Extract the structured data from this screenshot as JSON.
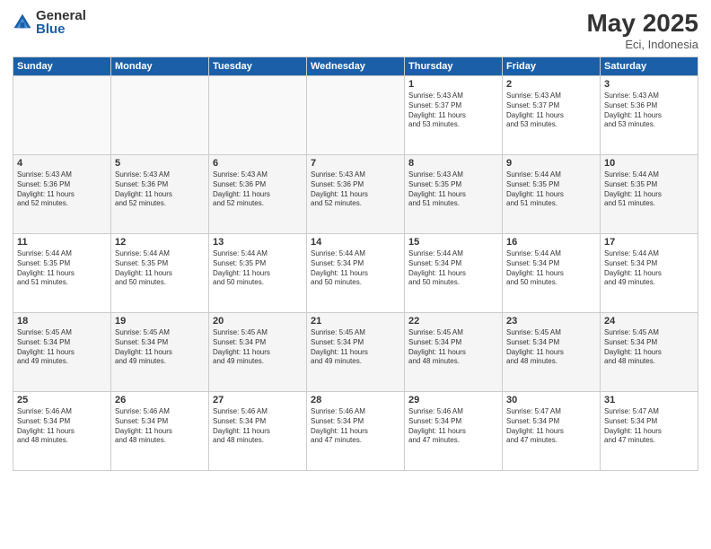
{
  "header": {
    "logo_general": "General",
    "logo_blue": "Blue",
    "month_year": "May 2025",
    "location": "Eci, Indonesia"
  },
  "days_of_week": [
    "Sunday",
    "Monday",
    "Tuesday",
    "Wednesday",
    "Thursday",
    "Friday",
    "Saturday"
  ],
  "weeks": [
    [
      {
        "day": "",
        "lines": []
      },
      {
        "day": "",
        "lines": []
      },
      {
        "day": "",
        "lines": []
      },
      {
        "day": "",
        "lines": []
      },
      {
        "day": "1",
        "lines": [
          "Sunrise: 5:43 AM",
          "Sunset: 5:37 PM",
          "Daylight: 11 hours",
          "and 53 minutes."
        ]
      },
      {
        "day": "2",
        "lines": [
          "Sunrise: 5:43 AM",
          "Sunset: 5:37 PM",
          "Daylight: 11 hours",
          "and 53 minutes."
        ]
      },
      {
        "day": "3",
        "lines": [
          "Sunrise: 5:43 AM",
          "Sunset: 5:36 PM",
          "Daylight: 11 hours",
          "and 53 minutes."
        ]
      }
    ],
    [
      {
        "day": "4",
        "lines": [
          "Sunrise: 5:43 AM",
          "Sunset: 5:36 PM",
          "Daylight: 11 hours",
          "and 52 minutes."
        ]
      },
      {
        "day": "5",
        "lines": [
          "Sunrise: 5:43 AM",
          "Sunset: 5:36 PM",
          "Daylight: 11 hours",
          "and 52 minutes."
        ]
      },
      {
        "day": "6",
        "lines": [
          "Sunrise: 5:43 AM",
          "Sunset: 5:36 PM",
          "Daylight: 11 hours",
          "and 52 minutes."
        ]
      },
      {
        "day": "7",
        "lines": [
          "Sunrise: 5:43 AM",
          "Sunset: 5:36 PM",
          "Daylight: 11 hours",
          "and 52 minutes."
        ]
      },
      {
        "day": "8",
        "lines": [
          "Sunrise: 5:43 AM",
          "Sunset: 5:35 PM",
          "Daylight: 11 hours",
          "and 51 minutes."
        ]
      },
      {
        "day": "9",
        "lines": [
          "Sunrise: 5:44 AM",
          "Sunset: 5:35 PM",
          "Daylight: 11 hours",
          "and 51 minutes."
        ]
      },
      {
        "day": "10",
        "lines": [
          "Sunrise: 5:44 AM",
          "Sunset: 5:35 PM",
          "Daylight: 11 hours",
          "and 51 minutes."
        ]
      }
    ],
    [
      {
        "day": "11",
        "lines": [
          "Sunrise: 5:44 AM",
          "Sunset: 5:35 PM",
          "Daylight: 11 hours",
          "and 51 minutes."
        ]
      },
      {
        "day": "12",
        "lines": [
          "Sunrise: 5:44 AM",
          "Sunset: 5:35 PM",
          "Daylight: 11 hours",
          "and 50 minutes."
        ]
      },
      {
        "day": "13",
        "lines": [
          "Sunrise: 5:44 AM",
          "Sunset: 5:35 PM",
          "Daylight: 11 hours",
          "and 50 minutes."
        ]
      },
      {
        "day": "14",
        "lines": [
          "Sunrise: 5:44 AM",
          "Sunset: 5:34 PM",
          "Daylight: 11 hours",
          "and 50 minutes."
        ]
      },
      {
        "day": "15",
        "lines": [
          "Sunrise: 5:44 AM",
          "Sunset: 5:34 PM",
          "Daylight: 11 hours",
          "and 50 minutes."
        ]
      },
      {
        "day": "16",
        "lines": [
          "Sunrise: 5:44 AM",
          "Sunset: 5:34 PM",
          "Daylight: 11 hours",
          "and 50 minutes."
        ]
      },
      {
        "day": "17",
        "lines": [
          "Sunrise: 5:44 AM",
          "Sunset: 5:34 PM",
          "Daylight: 11 hours",
          "and 49 minutes."
        ]
      }
    ],
    [
      {
        "day": "18",
        "lines": [
          "Sunrise: 5:45 AM",
          "Sunset: 5:34 PM",
          "Daylight: 11 hours",
          "and 49 minutes."
        ]
      },
      {
        "day": "19",
        "lines": [
          "Sunrise: 5:45 AM",
          "Sunset: 5:34 PM",
          "Daylight: 11 hours",
          "and 49 minutes."
        ]
      },
      {
        "day": "20",
        "lines": [
          "Sunrise: 5:45 AM",
          "Sunset: 5:34 PM",
          "Daylight: 11 hours",
          "and 49 minutes."
        ]
      },
      {
        "day": "21",
        "lines": [
          "Sunrise: 5:45 AM",
          "Sunset: 5:34 PM",
          "Daylight: 11 hours",
          "and 49 minutes."
        ]
      },
      {
        "day": "22",
        "lines": [
          "Sunrise: 5:45 AM",
          "Sunset: 5:34 PM",
          "Daylight: 11 hours",
          "and 48 minutes."
        ]
      },
      {
        "day": "23",
        "lines": [
          "Sunrise: 5:45 AM",
          "Sunset: 5:34 PM",
          "Daylight: 11 hours",
          "and 48 minutes."
        ]
      },
      {
        "day": "24",
        "lines": [
          "Sunrise: 5:45 AM",
          "Sunset: 5:34 PM",
          "Daylight: 11 hours",
          "and 48 minutes."
        ]
      }
    ],
    [
      {
        "day": "25",
        "lines": [
          "Sunrise: 5:46 AM",
          "Sunset: 5:34 PM",
          "Daylight: 11 hours",
          "and 48 minutes."
        ]
      },
      {
        "day": "26",
        "lines": [
          "Sunrise: 5:46 AM",
          "Sunset: 5:34 PM",
          "Daylight: 11 hours",
          "and 48 minutes."
        ]
      },
      {
        "day": "27",
        "lines": [
          "Sunrise: 5:46 AM",
          "Sunset: 5:34 PM",
          "Daylight: 11 hours",
          "and 48 minutes."
        ]
      },
      {
        "day": "28",
        "lines": [
          "Sunrise: 5:46 AM",
          "Sunset: 5:34 PM",
          "Daylight: 11 hours",
          "and 47 minutes."
        ]
      },
      {
        "day": "29",
        "lines": [
          "Sunrise: 5:46 AM",
          "Sunset: 5:34 PM",
          "Daylight: 11 hours",
          "and 47 minutes."
        ]
      },
      {
        "day": "30",
        "lines": [
          "Sunrise: 5:47 AM",
          "Sunset: 5:34 PM",
          "Daylight: 11 hours",
          "and 47 minutes."
        ]
      },
      {
        "day": "31",
        "lines": [
          "Sunrise: 5:47 AM",
          "Sunset: 5:34 PM",
          "Daylight: 11 hours",
          "and 47 minutes."
        ]
      }
    ]
  ]
}
